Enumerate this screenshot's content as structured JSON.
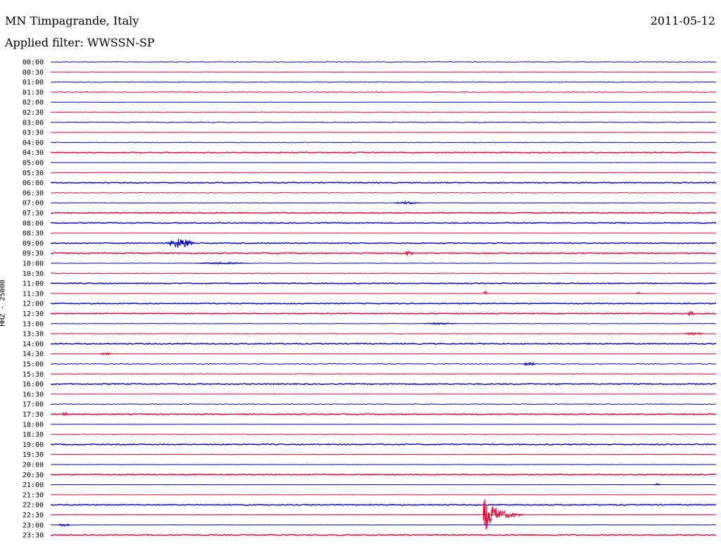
{
  "header": {
    "station": "MN Timpagrande, Italy",
    "date": "2011-05-12",
    "filter": "Applied filter: WWSSN-SP"
  },
  "chart_data": {
    "type": "line",
    "title": "MN Timpagrande, Italy",
    "ylabel": "HHZ - 25000",
    "row_labels": [
      "00:00",
      "00:30",
      "01:00",
      "01:30",
      "02:00",
      "02:30",
      "03:00",
      "03:30",
      "04:00",
      "04:30",
      "05:00",
      "05:30",
      "06:00",
      "06:30",
      "07:00",
      "07:30",
      "08:00",
      "08:30",
      "09:00",
      "09:30",
      "10:00",
      "10:30",
      "11:00",
      "11:30",
      "12:00",
      "12:30",
      "13:00",
      "13:30",
      "14:00",
      "14:30",
      "15:00",
      "15:30",
      "16:00",
      "16:30",
      "17:00",
      "17:30",
      "18:00",
      "18:30",
      "19:00",
      "19:30",
      "20:00",
      "20:30",
      "21:00",
      "21:30",
      "22:00",
      "22:30",
      "23:00",
      "23:30"
    ],
    "row_colors": [
      "#0000cc",
      "#ee0033"
    ],
    "row_noise_level": [
      0.5,
      0.2,
      0.6,
      0.7,
      0.2,
      0.6,
      0.7,
      0.2,
      0.6,
      0.8,
      0.2,
      0.6,
      0.8,
      0.5,
      0.3,
      0.8,
      0.8,
      0.2,
      0.8,
      0.8,
      0.3,
      0.5,
      0.8,
      0.2,
      0.8,
      0.8,
      0.4,
      0.5,
      0.9,
      0.2,
      0.7,
      0.6,
      0.9,
      0.2,
      0.6,
      0.9,
      0.2,
      0.5,
      0.9,
      0.3,
      0.4,
      0.9,
      0.2,
      0.2,
      0.9,
      0.2,
      0.2,
      0.9
    ],
    "events": [
      {
        "row": "09:00",
        "minute": 5.2,
        "duration_min": 1.3,
        "amplitude": 7
      },
      {
        "row": "09:30",
        "minute": 15.9,
        "duration_min": 0.5,
        "amplitude": 4
      },
      {
        "row": "07:00",
        "minute": 15.5,
        "duration_min": 1.2,
        "amplitude": 2
      },
      {
        "row": "10:00",
        "minute": 6.5,
        "duration_min": 2.5,
        "amplitude": 1.5
      },
      {
        "row": "11:30",
        "minute": 19.5,
        "duration_min": 0.2,
        "amplitude": 4
      },
      {
        "row": "11:30",
        "minute": 26.4,
        "duration_min": 0.2,
        "amplitude": 2
      },
      {
        "row": "12:30",
        "minute": 28.7,
        "duration_min": 0.3,
        "amplitude": 5
      },
      {
        "row": "13:00",
        "minute": 16.8,
        "duration_min": 1.5,
        "amplitude": 1.5
      },
      {
        "row": "13:30",
        "minute": 28.5,
        "duration_min": 1.0,
        "amplitude": 2
      },
      {
        "row": "14:30",
        "minute": 2.2,
        "duration_min": 0.6,
        "amplitude": 2
      },
      {
        "row": "15:00",
        "minute": 21.3,
        "duration_min": 0.6,
        "amplitude": 3
      },
      {
        "row": "17:30",
        "minute": 0.5,
        "duration_min": 0.3,
        "amplitude": 3
      },
      {
        "row": "21:00",
        "minute": 27.2,
        "duration_min": 0.3,
        "amplitude": 2
      },
      {
        "row": "22:30",
        "minute": 19.5,
        "duration_min": 1.8,
        "amplitude": 26
      },
      {
        "row": "23:00",
        "minute": 0.3,
        "duration_min": 0.6,
        "amplitude": 2
      }
    ]
  }
}
